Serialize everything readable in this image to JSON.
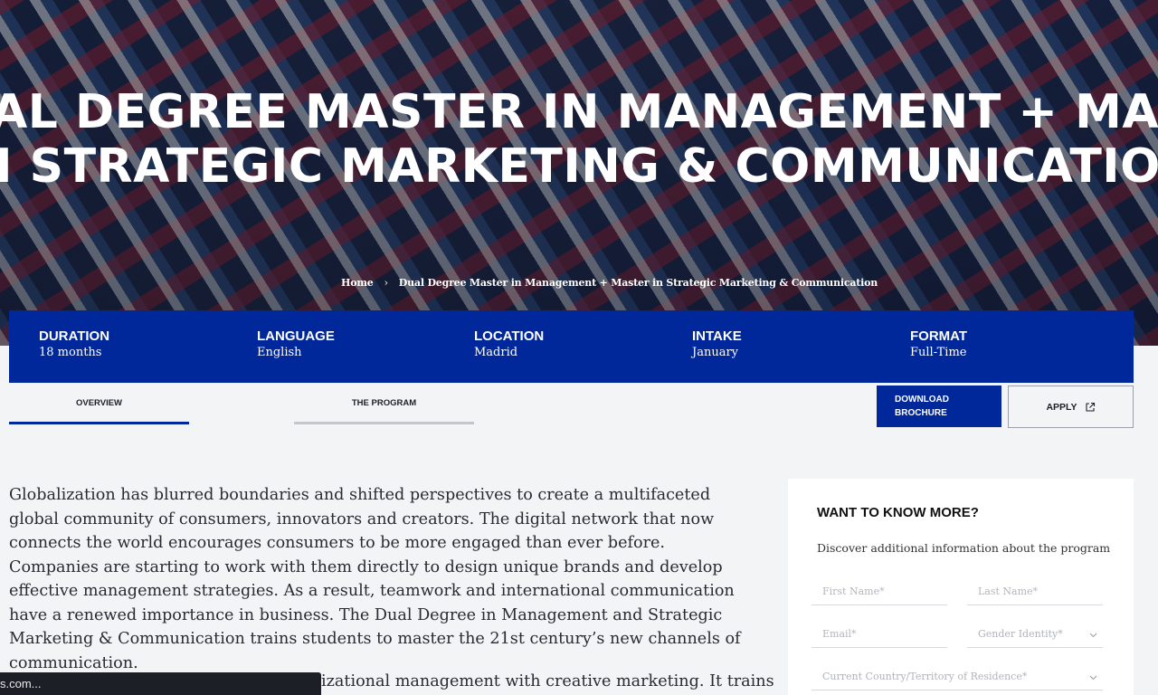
{
  "hero": {
    "title_line1": "AL DEGREE MASTER IN MANAGEMENT + MAST",
    "title_line2": "N STRATEGIC MARKETING & COMMUNICATION"
  },
  "breadcrumb": {
    "home": "Home",
    "separator": "›",
    "current": "Dual Degree Master in Management + Master in Strategic Marketing & Communication"
  },
  "info": [
    {
      "label": "DURATION",
      "value": "18 months"
    },
    {
      "label": "LANGUAGE",
      "value": "English"
    },
    {
      "label": "LOCATION",
      "value": "Madrid"
    },
    {
      "label": "INTAKE",
      "value": "January"
    },
    {
      "label": "FORMAT",
      "value": "Full-Time"
    }
  ],
  "tabs": [
    {
      "label": "OVERVIEW",
      "active": true
    },
    {
      "label": "THE PROGRAM",
      "active": false
    }
  ],
  "buttons": {
    "download_line1": "DOWNLOAD",
    "download_line2": "BROCHURE",
    "apply": "APPLY"
  },
  "body": {
    "paragraph1": "Globalization has blurred boundaries and shifted perspectives to create a multifaceted global community of consumers, innovators and creators. The digital network that now connects the world encourages consumers to be more engaged than ever before. Companies are starting to work with them directly to design unique brands and develop effective management strategies. As a result, teamwork and international communication have a renewed importance in business. The Dual Degree in Management and Strategic Marketing & Communication trains students to master the 21st century’s new channels of communication.",
    "paragraph2_visible": "izational management with creative marketing. It trains"
  },
  "status_url": "s.com...",
  "form": {
    "title": "WANT TO KNOW MORE?",
    "subtitle": "Discover additional information about the program",
    "first_name": "First Name*",
    "last_name": "Last Name*",
    "email": "Email*",
    "gender": "Gender Identity*",
    "country": "Current Country/Territory of Residence*"
  },
  "colors": {
    "brand_blue": "#00289a",
    "text_dark": "#2a2a33"
  }
}
